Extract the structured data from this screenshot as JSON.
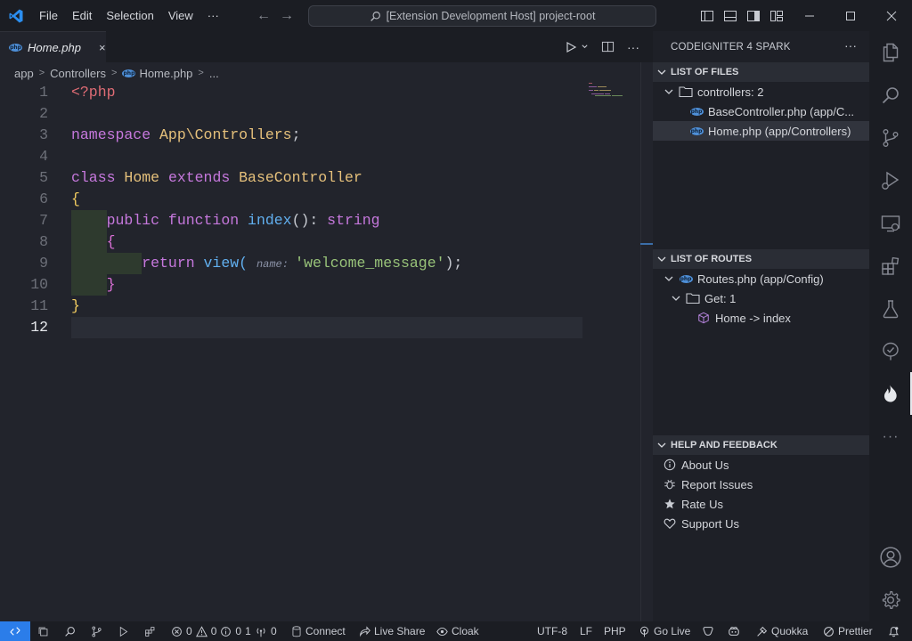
{
  "titlebar": {
    "menus": [
      "File",
      "Edit",
      "Selection",
      "View"
    ],
    "more": "···",
    "command_center": "[Extension Development Host] project-root"
  },
  "editor": {
    "tab_label": "Home.php",
    "tab_close": "×",
    "breadcrumb": [
      "app",
      "Controllers",
      "Home.php",
      "..."
    ],
    "lines": [
      {
        "n": "1",
        "tokens": [
          {
            "t": "<?php",
            "c": "tok-tag"
          }
        ]
      },
      {
        "n": "2",
        "tokens": []
      },
      {
        "n": "3",
        "tokens": [
          {
            "t": "namespace ",
            "c": "tok-kw"
          },
          {
            "t": "App\\Controllers",
            "c": "tok-ns"
          },
          {
            "t": ";",
            "c": "tok-plain"
          }
        ]
      },
      {
        "n": "4",
        "tokens": []
      },
      {
        "n": "5",
        "tokens": [
          {
            "t": "class ",
            "c": "tok-kw"
          },
          {
            "t": "Home ",
            "c": "tok-ns"
          },
          {
            "t": "extends ",
            "c": "tok-kw"
          },
          {
            "t": "BaseController",
            "c": "tok-ns"
          }
        ]
      },
      {
        "n": "6",
        "tokens": [
          {
            "t": "{",
            "c": "tok-brace"
          }
        ]
      },
      {
        "n": "7",
        "tokens": [
          {
            "t": "    public ",
            "c": "tok-kw"
          },
          {
            "t": "function ",
            "c": "tok-kw"
          },
          {
            "t": "index",
            "c": "tok-fn"
          },
          {
            "t": "(): ",
            "c": "tok-plain"
          },
          {
            "t": "string",
            "c": "tok-kw"
          }
        ]
      },
      {
        "n": "8",
        "tokens": [
          {
            "t": "    {",
            "c": "tok-brace2"
          }
        ]
      },
      {
        "n": "9",
        "tokens": [
          {
            "t": "        return ",
            "c": "tok-kw"
          },
          {
            "t": "view",
            "c": "tok-fn"
          },
          {
            "t": "( ",
            "c": "tok-fn"
          },
          {
            "t": "name: ",
            "c": "tok-hint"
          },
          {
            "t": "'welcome_message'",
            "c": "tok-str"
          },
          {
            "t": ");",
            "c": "tok-plain"
          }
        ]
      },
      {
        "n": "10",
        "tokens": [
          {
            "t": "    }",
            "c": "tok-brace2"
          }
        ]
      },
      {
        "n": "11",
        "tokens": [
          {
            "t": "}",
            "c": "tok-brace"
          }
        ]
      },
      {
        "n": "12",
        "tokens": []
      }
    ],
    "active_line": "12"
  },
  "sidebar": {
    "title": "CODEIGNITER 4 SPARK",
    "more": "···",
    "files": {
      "header": "LIST OF FILES",
      "folder": "controllers: 2",
      "items": [
        "BaseController.php (app/C...",
        "Home.php (app/Controllers)"
      ]
    },
    "routes": {
      "header": "LIST OF ROUTES",
      "file": "Routes.php (app/Config)",
      "method": "Get: 1",
      "route": "Home -> index"
    },
    "help": {
      "header": "HELP AND FEEDBACK",
      "items": [
        "About Us",
        "Report Issues",
        "Rate Us",
        "Support Us"
      ]
    }
  },
  "statusbar": {
    "errors": "0",
    "warnings": "0",
    "infos": "0",
    "ports": "1",
    "broadcast": "0",
    "connect": "Connect",
    "live_share": "Live Share",
    "cloak": "Cloak",
    "encoding": "UTF-8",
    "eol": "LF",
    "language": "PHP",
    "go_live": "Go Live",
    "quokka": "Quokka",
    "prettier": "Prettier"
  },
  "colors": {
    "accent": "#2b7de9",
    "php_badge": "#4e8fd8",
    "flame": "#e6e8ec"
  }
}
